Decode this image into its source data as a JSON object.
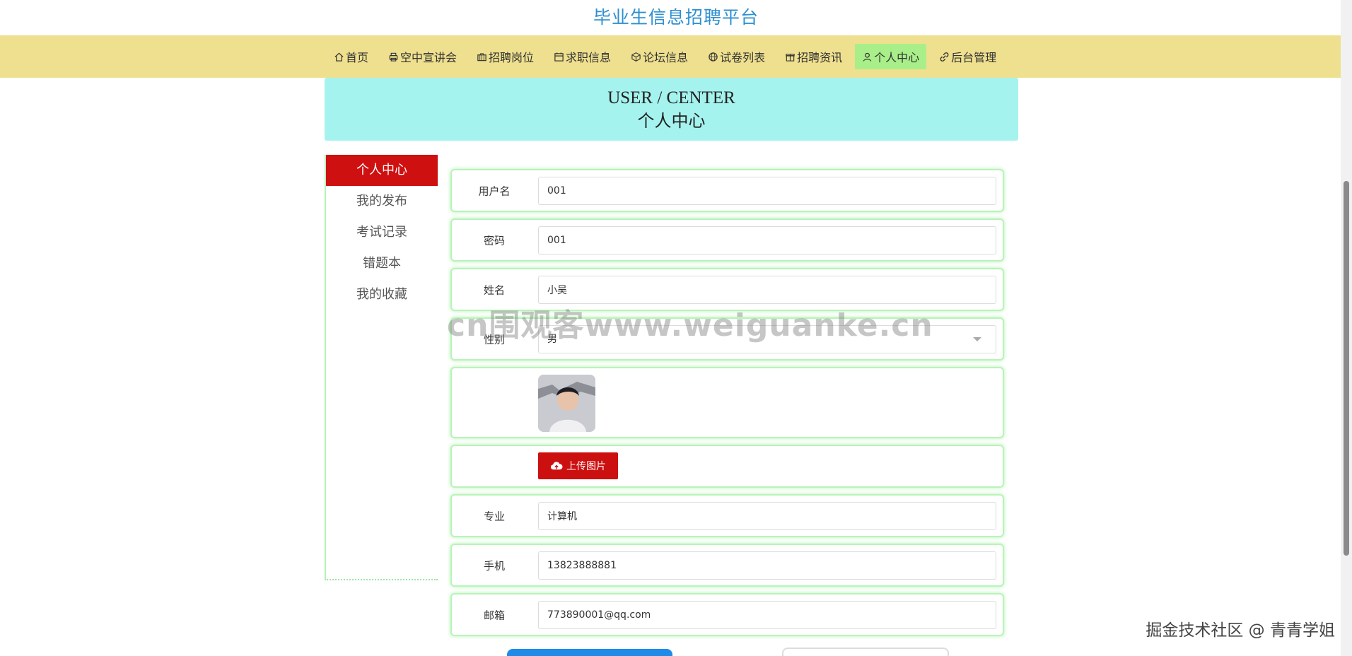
{
  "site": {
    "title": "毕业生信息招聘平台"
  },
  "nav": {
    "items": [
      {
        "label": "首页",
        "icon": "home-icon"
      },
      {
        "label": "空中宣讲会",
        "icon": "print-icon"
      },
      {
        "label": "招聘岗位",
        "icon": "briefcase-icon"
      },
      {
        "label": "求职信息",
        "icon": "calendar-icon"
      },
      {
        "label": "论坛信息",
        "icon": "box-icon"
      },
      {
        "label": "试卷列表",
        "icon": "globe-icon"
      },
      {
        "label": "招聘资讯",
        "icon": "gift-icon"
      },
      {
        "label": "个人中心",
        "icon": "user-icon",
        "active": true
      },
      {
        "label": "后台管理",
        "icon": "link-icon"
      }
    ],
    "active_color": "#a8ef8a",
    "bar_color": "#eee08e"
  },
  "banner": {
    "en": "USER / CENTER",
    "cn": "个人中心"
  },
  "sidebar": {
    "items": [
      {
        "label": "个人中心",
        "active": true
      },
      {
        "label": "我的发布"
      },
      {
        "label": "考试记录"
      },
      {
        "label": "错题本"
      },
      {
        "label": "我的收藏"
      }
    ]
  },
  "form": {
    "username": {
      "label": "用户名",
      "value": "001"
    },
    "password": {
      "label": "密码",
      "value": "001"
    },
    "name": {
      "label": "姓名",
      "value": "小吴"
    },
    "gender": {
      "label": "性别",
      "value": "男"
    },
    "upload_label": "上传图片",
    "major": {
      "label": "专业",
      "value": "计算机"
    },
    "phone": {
      "label": "手机",
      "value": "13823888881"
    },
    "email": {
      "label": "邮箱",
      "value": "773890001@qq.com"
    }
  },
  "watermark": "cn围观客www.weiguanke.cn",
  "corner_mark": "掘金技术社区 @ 青青学姐"
}
